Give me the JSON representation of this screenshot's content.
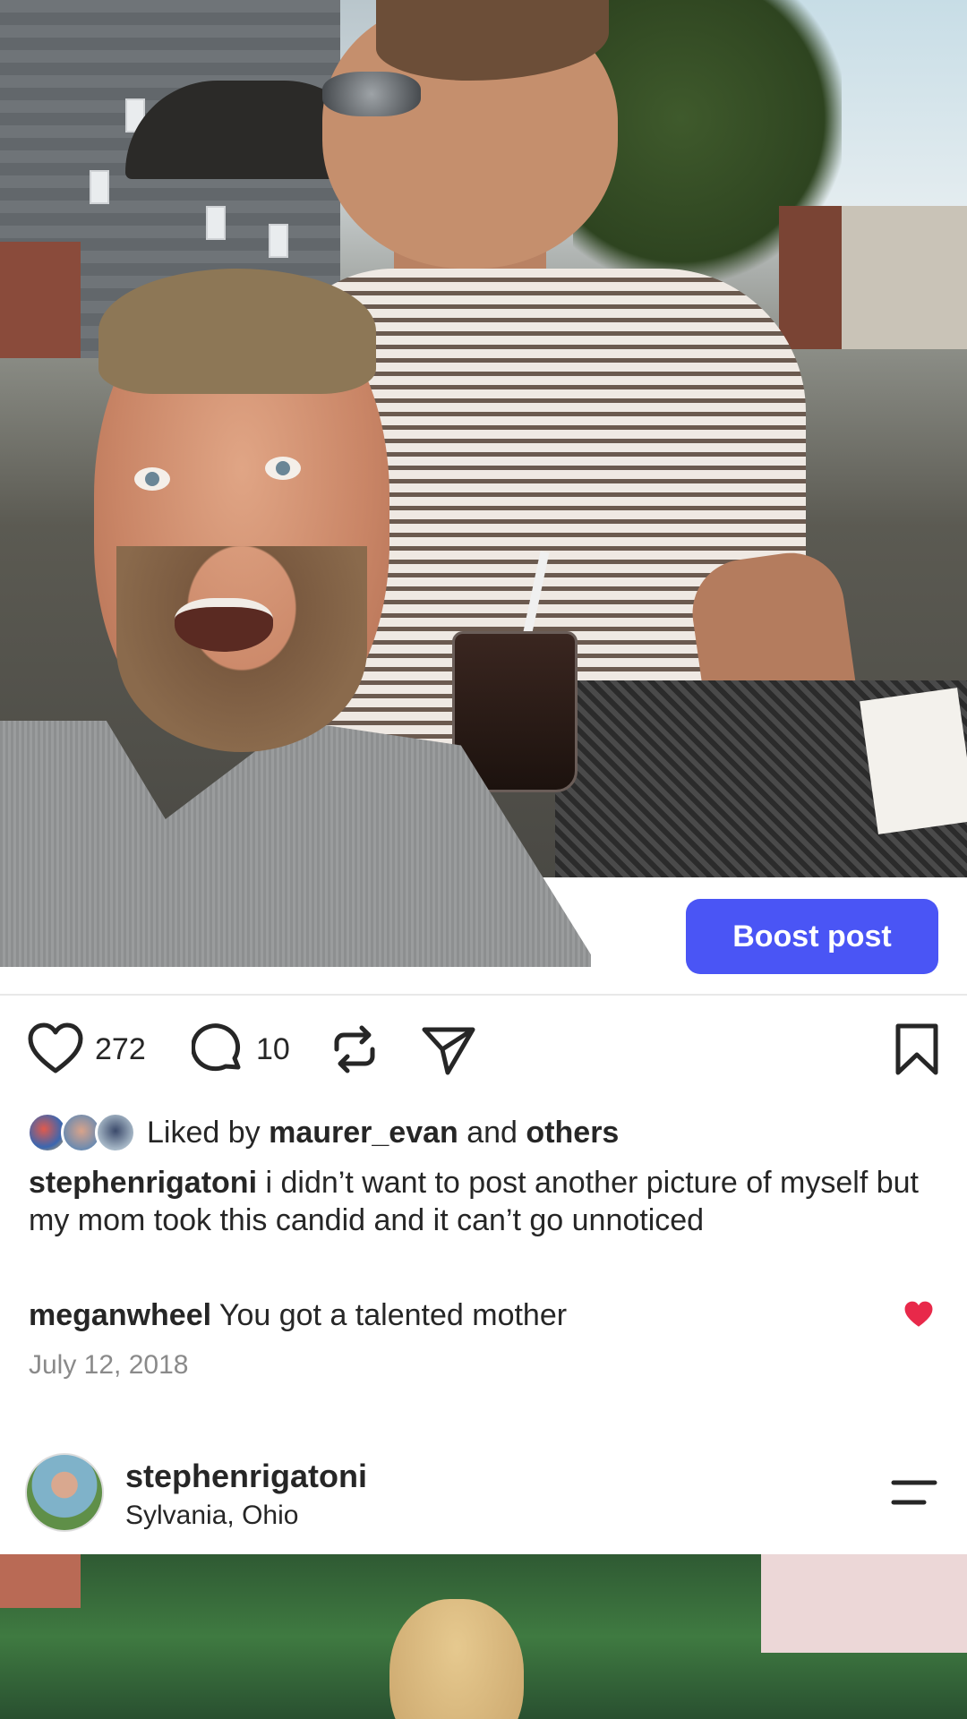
{
  "post": {
    "boost_label": "Boost post",
    "like_count": "272",
    "comment_count": "10",
    "liked_by_prefix": "Liked by",
    "liked_by_user": "maurer_evan",
    "liked_by_and": "and",
    "liked_by_others": "others",
    "caption_user": "stephenrigatoni",
    "caption_text": "i didn’t want to post another picture of myself but my mom took this candid and it can’t go unnoticed",
    "comment_user": "meganwheel",
    "comment_text": "You got a talented mother",
    "date": "July 12, 2018"
  },
  "next_post": {
    "username": "stephenrigatoni",
    "location": "Sylvania, Ohio"
  },
  "icons": {
    "like": "heart-outline-icon",
    "comment": "comment-bubble-icon",
    "repost": "repost-icon",
    "share": "send-icon",
    "save": "bookmark-icon",
    "comment_like": "heart-filled-icon",
    "menu": "menu-lines-icon"
  },
  "colors": {
    "accent": "#4a55f5",
    "heart": "#e8294a",
    "muted": "#8a8a8a"
  }
}
